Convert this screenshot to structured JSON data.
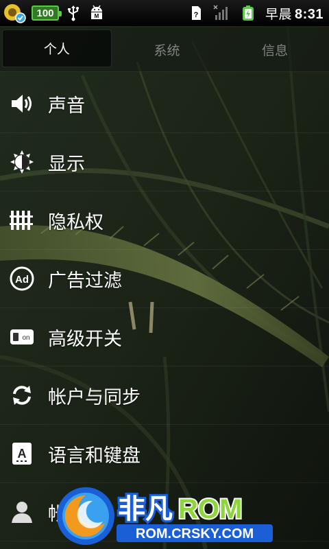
{
  "status_bar": {
    "battery_level": "100",
    "am_pm": "早晨",
    "time": "8:31",
    "icons": [
      "app-badge-icon",
      "battery-icon",
      "usb-icon",
      "debug-android-icon",
      "sdcard-icon",
      "signal-bars-icon",
      "charging-battery-icon"
    ]
  },
  "tabs": [
    {
      "label": "个人",
      "active": true
    },
    {
      "label": "系统",
      "active": false
    },
    {
      "label": "信息",
      "active": false
    }
  ],
  "settings": [
    {
      "label": "声音",
      "icon": "speaker-icon"
    },
    {
      "label": "显示",
      "icon": "brightness-icon"
    },
    {
      "label": "隐私权",
      "icon": "privacy-fence-icon"
    },
    {
      "label": "广告过滤",
      "icon": "ad-block-icon"
    },
    {
      "label": "高级开关",
      "icon": "toggle-on-icon"
    },
    {
      "label": "帐户与同步",
      "icon": "sync-icon"
    },
    {
      "label": "语言和键盘",
      "icon": "keyboard-a-icon"
    },
    {
      "label": "帐户",
      "icon": "person-icon"
    }
  ],
  "watermark": {
    "brand_cn": "非凡",
    "brand_rom": "ROM",
    "site": "ROM.CRSKY.COM"
  },
  "colors": {
    "status_bar": "#000000",
    "battery_green": "#5ec84a",
    "watermark_blue": "#1a5fd6",
    "watermark_orange": "#f39a1e",
    "watermark_green": "#8cd63a"
  }
}
